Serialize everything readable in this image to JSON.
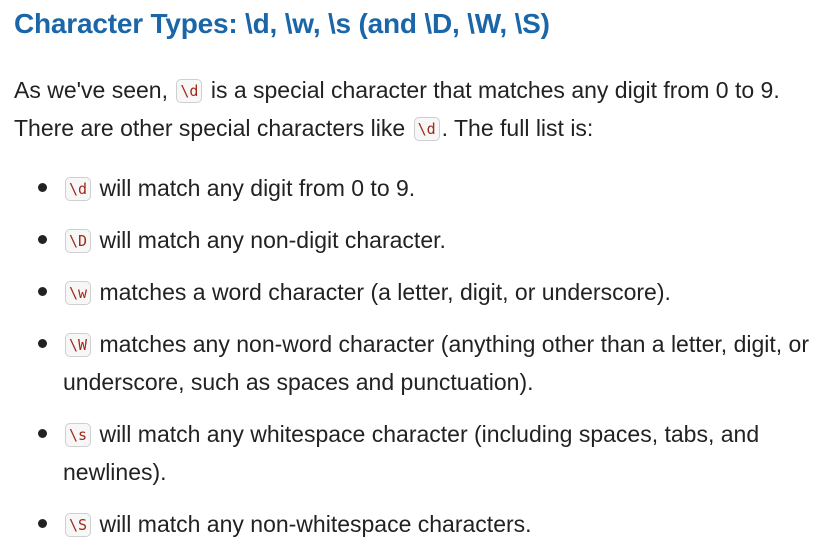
{
  "heading": "Character Types: \\d, \\w, \\s (and \\D, \\W, \\S)",
  "intro": {
    "part1": "As we've seen,",
    "code1": "\\d",
    "part2": "is a special character that matches any digit from 0 to 9. There are other special characters like",
    "code2": "\\d",
    "part3": ". The full list is:"
  },
  "items": [
    {
      "code": "\\d",
      "text": "will match any digit from 0 to 9."
    },
    {
      "code": "\\D",
      "text": "will match any non-digit character."
    },
    {
      "code": "\\w",
      "text": "matches a word character (a letter, digit, or underscore)."
    },
    {
      "code": "\\W",
      "text": "matches any non-word character (anything other than a letter, digit, or underscore, such as spaces and punctuation)."
    },
    {
      "code": "\\s",
      "text": "will match any whitespace character (including spaces, tabs, and newlines)."
    },
    {
      "code": "\\S",
      "text": "will match any non-whitespace characters."
    }
  ],
  "colors": {
    "heading": "#1a66a8",
    "text": "#222222",
    "code_text": "#a02a18",
    "code_bg": "#f7f7f7",
    "code_border": "#cfcfcf"
  }
}
